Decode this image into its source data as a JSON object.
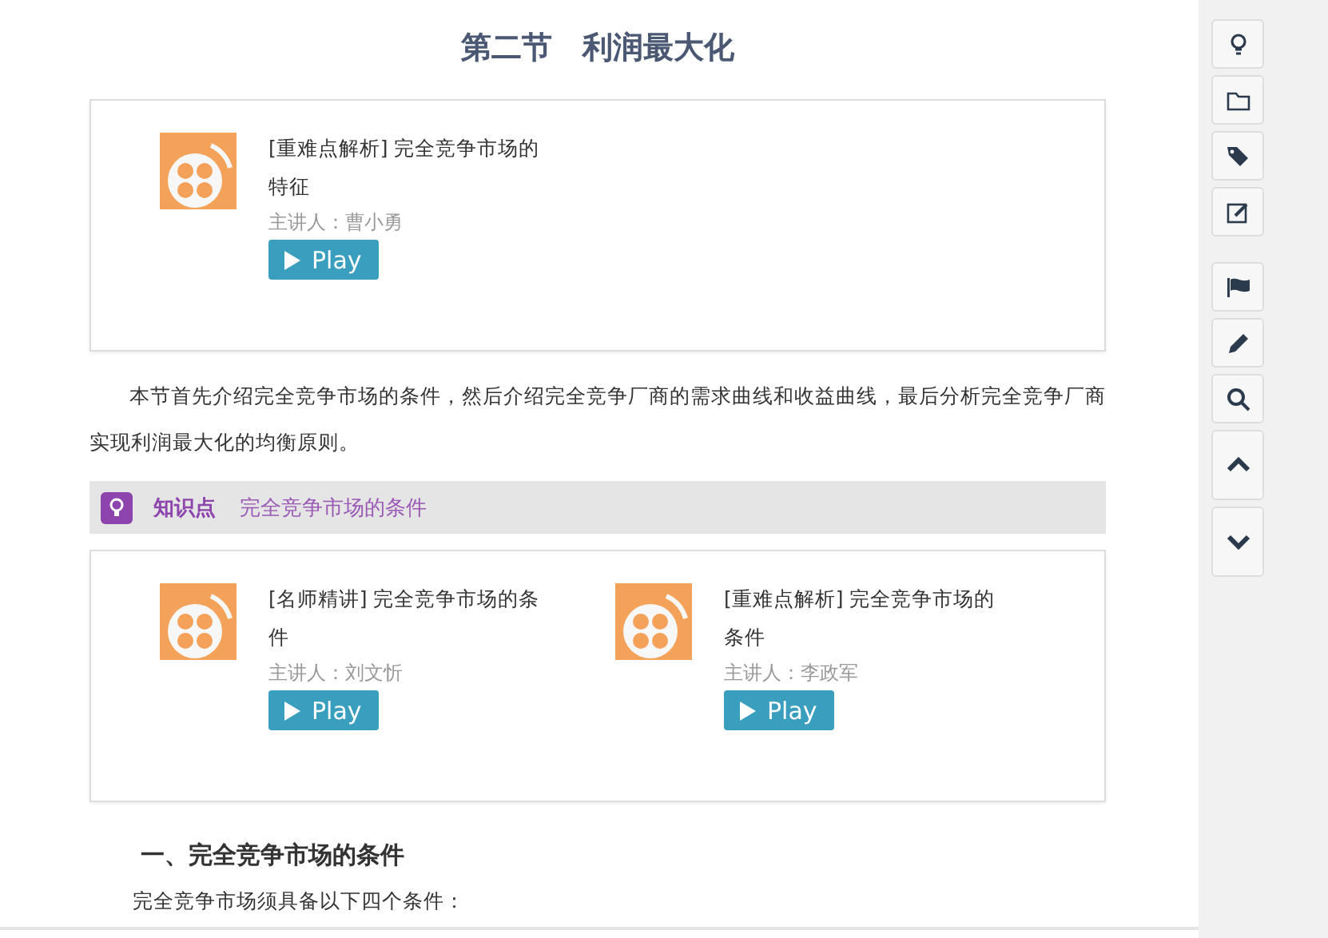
{
  "title": "第二节　利润最大化",
  "video_cards": [
    {
      "videos": [
        {
          "title": "[重难点解析] 完全竞争市场的特征",
          "speaker": "主讲人：曹小勇",
          "button": "Play"
        }
      ]
    },
    {
      "videos": [
        {
          "title": "[名师精讲] 完全竞争市场的条件",
          "speaker": "主讲人：刘文忻",
          "button": "Play"
        },
        {
          "title": "[重难点解析] 完全竞争市场的条件",
          "speaker": "主讲人：李政军",
          "button": "Play"
        }
      ]
    }
  ],
  "intro": "本节首先介绍完全竞争市场的条件，然后介绍完全竞争厂商的需求曲线和收益曲线，最后分析完全竞争厂商实现利润最大化的均衡原则。",
  "knowledge": {
    "label": "知识点",
    "topic": "完全竞争市场的条件"
  },
  "section_heading": "一、完全竞争市场的条件",
  "section_text": "完全竞争市场须具备以下四个条件：",
  "sidebar_tools": [
    {
      "kind": "bulb"
    },
    {
      "kind": "folder"
    },
    {
      "kind": "tag"
    },
    {
      "kind": "note"
    },
    {
      "kind": "flag"
    },
    {
      "kind": "pencil"
    },
    {
      "kind": "search"
    },
    {
      "kind": "up"
    },
    {
      "kind": "down"
    }
  ]
}
